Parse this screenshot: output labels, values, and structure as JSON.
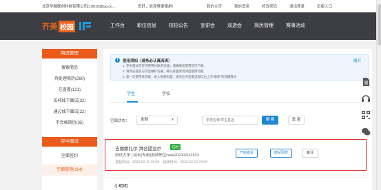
{
  "topbar": {
    "org": "北京华融联创科技有限公司(10010@qq.co...",
    "welcome": "您好，欢迎登录使用!",
    "links": [
      "我的主页",
      "我的消息",
      "修改密码",
      "退出登录",
      "旧版入口"
    ]
  },
  "logo": {
    "text1": "齐美",
    "text2": "校园"
  },
  "nav": {
    "items": [
      "工作台",
      "职位信息",
      "校招公告",
      "宣讲会",
      "双选会",
      "简历管理",
      "赛事活动"
    ]
  },
  "sidebar": {
    "section1": "简历管理",
    "items1": [
      "搜索简历",
      "待处理简历(260)",
      "已查看(121)",
      "安排线下面试(32)",
      "通过线下面试(22)",
      "不合格简历(35)"
    ],
    "section2": "空中面试",
    "items2": [
      "空面签约",
      "空面管理(114)"
    ]
  },
  "notice": {
    "info_glyph": "i",
    "title": "使用须知（请务必认真阅读）",
    "expand": "展开",
    "lines": [
      "1. 空中面试仅支持使用谷歌浏览器，请确保您使用前已下载",
      "2. 请务必提前与学生做好沟通，确认好面试时间后使用功能",
      "3. 第一次使用该功能，进入视频页面，请务必点击面试窗口右上方“刷新”检测摄像头"
    ]
  },
  "tabs": [
    "学生",
    "学校"
  ],
  "filter": {
    "label": "空面状态：",
    "select_value": "全部",
    "search_placeholder": "学校名称/学生姓名",
    "search_btn": "搜 索",
    "reset_btn": "重 置"
  },
  "card": {
    "name": "吉丽娜扎尔·拜合提亚尔",
    "badge": "已约",
    "school": "测试大学 | 综合(专用)测试职位case202002111533",
    "start": "发起时间：2020-02-11 15:00",
    "end": "结束时间：2020-02-12 23:00",
    "btn_start": "开始面试",
    "btn_record": "面试回放",
    "btn_note": "备注"
  },
  "card2": {
    "name": "小明明"
  },
  "icons": [
    "document-icon",
    "headset-icon",
    "qrcode-icon",
    "chat-icon"
  ],
  "colors": {
    "brand": "#e95a1b",
    "accent": "#1e88d4",
    "nav_bg": "#3d3e44",
    "highlight": "#e02a2a"
  }
}
